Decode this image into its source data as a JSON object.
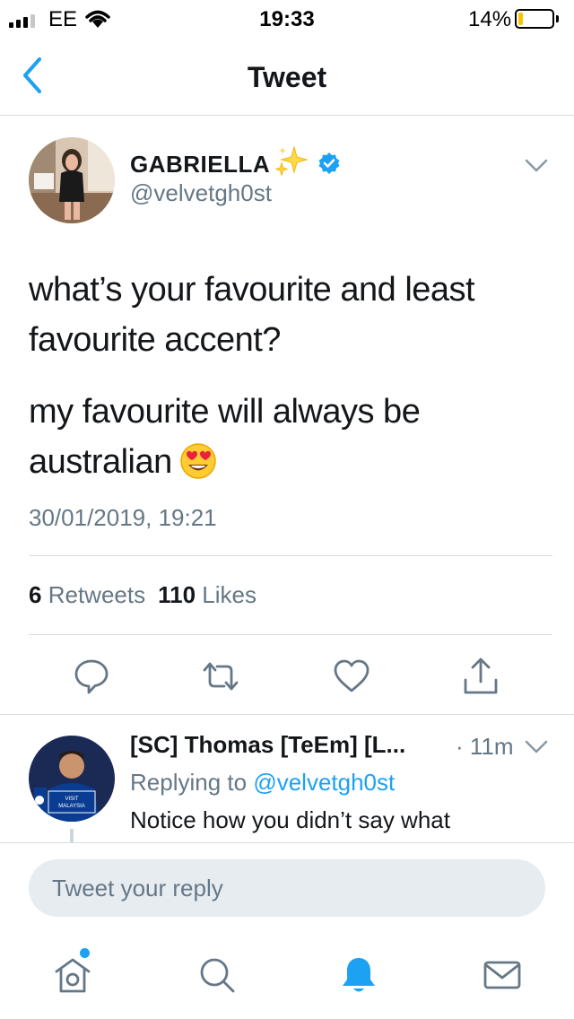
{
  "status_bar": {
    "carrier": "EE",
    "time": "19:33",
    "battery": "14%",
    "battery_level": 0.14
  },
  "nav": {
    "title": "Tweet",
    "back_icon": "chevron-left-icon"
  },
  "tweet": {
    "author_name": "GABRIELLA",
    "author_handle": "@velvetgh0st",
    "paragraphs": [
      "what’s your favourite and least favourite accent?",
      "my favourite will always be australian"
    ],
    "emoji": "heart-eyes-emoji",
    "timestamp": "30/01/2019, 19:21",
    "retweets_count": "6",
    "retweets_label": "Retweets",
    "likes_count": "110",
    "likes_label": "Likes",
    "actions": [
      "reply-icon",
      "retweet-icon",
      "like-icon",
      "share-icon"
    ]
  },
  "reply": {
    "author": "[SC] Thomas  [TeEm] [L...",
    "time": "· 11m",
    "replying_prefix": "Replying to",
    "replying_handle": "@velvetgh0st",
    "text": "Notice how you didn’t say what"
  },
  "composer": {
    "placeholder": "Tweet your reply"
  },
  "tab_bar": {
    "items": [
      "home-icon",
      "search-icon",
      "notifications-icon",
      "messages-icon"
    ],
    "active": "notifications-icon"
  },
  "colors": {
    "accent": "#1da1f2",
    "text": "#14171a",
    "muted": "#657786",
    "divider": "#d8dde1",
    "battery": "#f7c600"
  }
}
